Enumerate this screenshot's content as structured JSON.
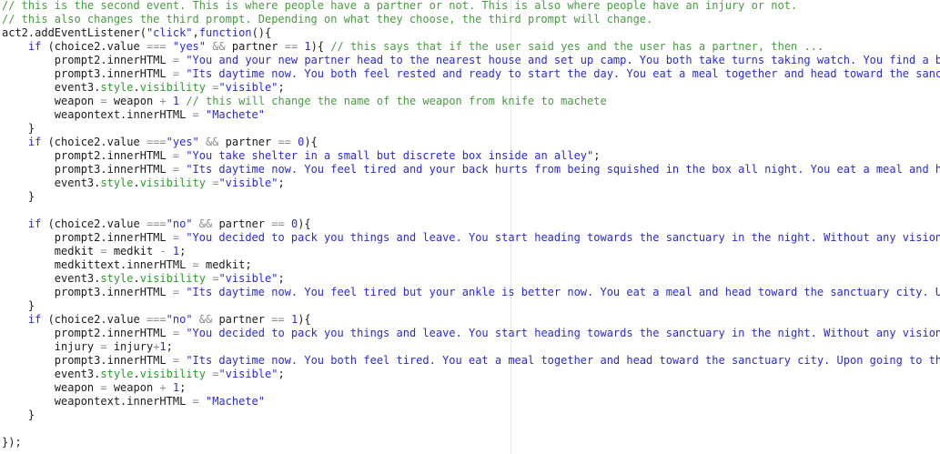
{
  "colors": {
    "background": "#ffffff",
    "plain": "#1b1b1b",
    "comment": "#4a9a43",
    "string": "#2a2ad6",
    "number": "#2a2ad6",
    "keyword": "#2a2ad6",
    "property": "#2e9a2e",
    "operator": "#8c8c8c"
  },
  "editor": {
    "lines": [
      [
        [
          "c",
          "// this is the second event. This is where people have a partner or not. This is also where people have an injury or not."
        ]
      ],
      [
        [
          "c",
          "// this also changes the third prompt. Depending on what they choose, the third prompt will change."
        ]
      ],
      [
        [
          "p",
          "act2.addEventListener("
        ],
        [
          "s",
          "\"click\""
        ],
        [
          "p",
          ","
        ],
        [
          "k",
          "function"
        ],
        [
          "p",
          "(){"
        ]
      ],
      [
        [
          "p",
          "    "
        ],
        [
          "k",
          "if"
        ],
        [
          "p",
          " (choice2.value "
        ],
        [
          "o",
          "==="
        ],
        [
          "p",
          " "
        ],
        [
          "s",
          "\"yes\""
        ],
        [
          "p",
          " "
        ],
        [
          "o",
          "&&"
        ],
        [
          "p",
          " partner "
        ],
        [
          "o",
          "=="
        ],
        [
          "p",
          " "
        ],
        [
          "n",
          "1"
        ],
        [
          "p",
          "){ "
        ],
        [
          "c",
          "// this says that if the user said yes and the user has a partner, then ..."
        ]
      ],
      [
        [
          "p",
          "        prompt2.innerHTML "
        ],
        [
          "o",
          "="
        ],
        [
          "p",
          " "
        ],
        [
          "s",
          "\"You and your new partner head to the nearest house and set up camp. You both take turns taking watch. You find a bat and a"
        ]
      ],
      [
        [
          "p",
          "        prompt3.innerHTML "
        ],
        [
          "o",
          "="
        ],
        [
          "p",
          " "
        ],
        [
          "s",
          "\"Its daytime now. You both feel rested and ready to start the day. You eat a meal together and head toward the sanctuary"
        ]
      ],
      [
        [
          "p",
          "        event3."
        ],
        [
          "g",
          "style"
        ],
        [
          "p",
          "."
        ],
        [
          "g",
          "visibility"
        ],
        [
          "p",
          " "
        ],
        [
          "o",
          "="
        ],
        [
          "s",
          "\"visible\""
        ],
        [
          "p",
          ";"
        ]
      ],
      [
        [
          "p",
          "        weapon "
        ],
        [
          "o",
          "="
        ],
        [
          "p",
          " weapon "
        ],
        [
          "o",
          "+"
        ],
        [
          "p",
          " "
        ],
        [
          "n",
          "1"
        ],
        [
          "p",
          " "
        ],
        [
          "c",
          "// this will change the name of the weapon from knife to machete"
        ]
      ],
      [
        [
          "p",
          "        weapontext.innerHTML "
        ],
        [
          "o",
          "="
        ],
        [
          "p",
          " "
        ],
        [
          "s",
          "\"Machete\""
        ]
      ],
      [
        [
          "p",
          "    }"
        ]
      ],
      [
        [
          "p",
          "    "
        ],
        [
          "k",
          "if"
        ],
        [
          "p",
          " (choice2.value "
        ],
        [
          "o",
          "==="
        ],
        [
          "s",
          "\"yes\""
        ],
        [
          "p",
          " "
        ],
        [
          "o",
          "&&"
        ],
        [
          "p",
          " partner "
        ],
        [
          "o",
          "=="
        ],
        [
          "p",
          " "
        ],
        [
          "n",
          "0"
        ],
        [
          "p",
          "){"
        ]
      ],
      [
        [
          "p",
          "        prompt2.innerHTML "
        ],
        [
          "o",
          "="
        ],
        [
          "p",
          " "
        ],
        [
          "s",
          "\"You take shelter in a small but discrete box inside an alley\""
        ],
        [
          "p",
          ";"
        ]
      ],
      [
        [
          "p",
          "        prompt3.innerHTML "
        ],
        [
          "o",
          "="
        ],
        [
          "p",
          " "
        ],
        [
          "s",
          "\"Its daytime now. You feel tired and your back hurts from being squished in the box all night. You eat a meal and head tow"
        ]
      ],
      [
        [
          "p",
          "        event3."
        ],
        [
          "g",
          "style"
        ],
        [
          "p",
          "."
        ],
        [
          "g",
          "visibility"
        ],
        [
          "p",
          " "
        ],
        [
          "o",
          "="
        ],
        [
          "s",
          "\"visible\""
        ],
        [
          "p",
          ";"
        ]
      ],
      [
        [
          "p",
          "    }"
        ]
      ],
      [
        [
          "p",
          ""
        ]
      ],
      [
        [
          "p",
          "    "
        ],
        [
          "k",
          "if"
        ],
        [
          "p",
          " (choice2.value "
        ],
        [
          "o",
          "==="
        ],
        [
          "s",
          "\"no\""
        ],
        [
          "p",
          " "
        ],
        [
          "o",
          "&&"
        ],
        [
          "p",
          " partner "
        ],
        [
          "o",
          "=="
        ],
        [
          "p",
          " "
        ],
        [
          "n",
          "0"
        ],
        [
          "p",
          "){"
        ]
      ],
      [
        [
          "p",
          "        prompt2.innerHTML "
        ],
        [
          "o",
          "="
        ],
        [
          "p",
          " "
        ],
        [
          "s",
          "\"You decided to pack you things and leave. You start heading towards the sanctuary in the night. Without any vision, you"
        ]
      ],
      [
        [
          "p",
          "        medkit "
        ],
        [
          "o",
          "="
        ],
        [
          "p",
          " medkit "
        ],
        [
          "o",
          "-"
        ],
        [
          "p",
          " "
        ],
        [
          "n",
          "1"
        ],
        [
          "p",
          ";"
        ]
      ],
      [
        [
          "p",
          "        medkittext.innerHTML "
        ],
        [
          "o",
          "="
        ],
        [
          "p",
          " medkit;"
        ]
      ],
      [
        [
          "p",
          "        event3."
        ],
        [
          "g",
          "style"
        ],
        [
          "p",
          "."
        ],
        [
          "g",
          "visibility"
        ],
        [
          "p",
          " "
        ],
        [
          "o",
          "="
        ],
        [
          "s",
          "\"visible\""
        ],
        [
          "p",
          ";"
        ]
      ],
      [
        [
          "p",
          "        prompt3.innerHTML "
        ],
        [
          "o",
          "="
        ],
        [
          "p",
          " "
        ],
        [
          "s",
          "\"Its daytime now. You feel tired but your ankle is better now. You eat a meal and head toward the sanctuary city. Upon goi"
        ]
      ],
      [
        [
          "p",
          "    }"
        ]
      ],
      [
        [
          "p",
          "    "
        ],
        [
          "k",
          "if"
        ],
        [
          "p",
          " (choice2.value "
        ],
        [
          "o",
          "==="
        ],
        [
          "s",
          "\"no\""
        ],
        [
          "p",
          " "
        ],
        [
          "o",
          "&&"
        ],
        [
          "p",
          " partner "
        ],
        [
          "o",
          "=="
        ],
        [
          "p",
          " "
        ],
        [
          "n",
          "1"
        ],
        [
          "p",
          "){"
        ]
      ],
      [
        [
          "p",
          "        prompt2.innerHTML "
        ],
        [
          "o",
          "="
        ],
        [
          "p",
          " "
        ],
        [
          "s",
          "\"You decided to pack you things and leave. You start heading towards the sanctuary in the night. Without any vision, you"
        ]
      ],
      [
        [
          "p",
          "        injury "
        ],
        [
          "o",
          "="
        ],
        [
          "p",
          " injury"
        ],
        [
          "o",
          "+"
        ],
        [
          "n",
          "1"
        ],
        [
          "p",
          ";"
        ]
      ],
      [
        [
          "p",
          "        prompt3.innerHTML "
        ],
        [
          "o",
          "="
        ],
        [
          "p",
          " "
        ],
        [
          "s",
          "\"Its daytime now. You both feel tired. You eat a meal together and head toward the sanctuary city. Upon going to the city"
        ]
      ],
      [
        [
          "p",
          "        event3."
        ],
        [
          "g",
          "style"
        ],
        [
          "p",
          "."
        ],
        [
          "g",
          "visibility"
        ],
        [
          "p",
          " "
        ],
        [
          "o",
          "="
        ],
        [
          "s",
          "\"visible\""
        ],
        [
          "p",
          ";"
        ]
      ],
      [
        [
          "p",
          "        weapon "
        ],
        [
          "o",
          "="
        ],
        [
          "p",
          " weapon "
        ],
        [
          "o",
          "+"
        ],
        [
          "p",
          " "
        ],
        [
          "n",
          "1"
        ],
        [
          "p",
          ";"
        ]
      ],
      [
        [
          "p",
          "        weapontext.innerHTML "
        ],
        [
          "o",
          "="
        ],
        [
          "p",
          " "
        ],
        [
          "s",
          "\"Machete\""
        ]
      ],
      [
        [
          "p",
          "    }"
        ]
      ],
      [
        [
          "p",
          ""
        ]
      ],
      [
        [
          "p",
          "});"
        ]
      ]
    ]
  }
}
